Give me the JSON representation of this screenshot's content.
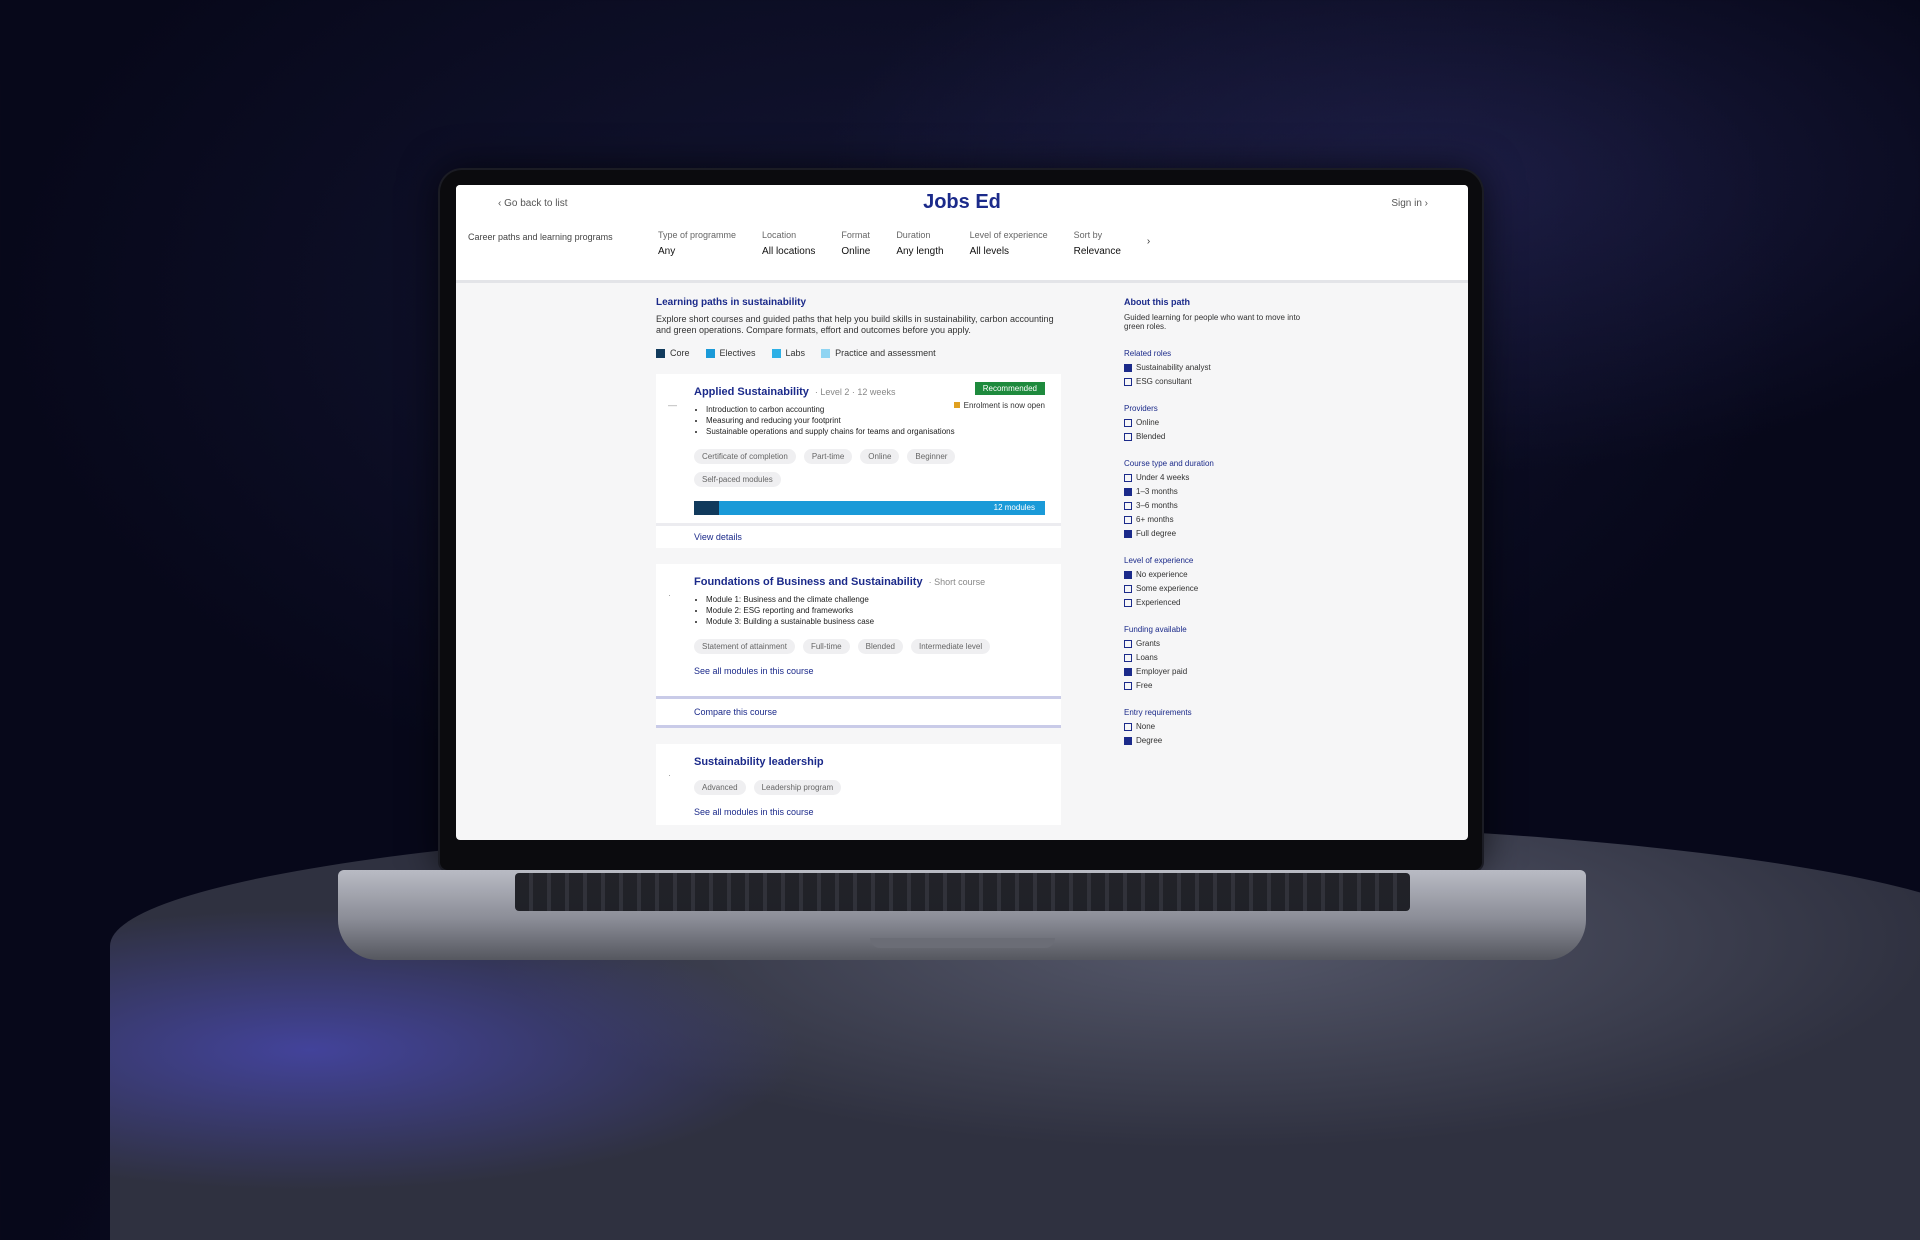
{
  "site": {
    "back_label": "‹ Go back to list",
    "logo": "Jobs Ed",
    "signin_label": "Sign in ›",
    "search_text": "Career paths and learning programs"
  },
  "filters": [
    {
      "label": "Type of programme",
      "value": "Any"
    },
    {
      "label": "Location",
      "value": "All locations"
    },
    {
      "label": "Format",
      "value": "Online"
    },
    {
      "label": "Duration",
      "value": "Any length"
    },
    {
      "label": "Level of experience",
      "value": "All levels"
    },
    {
      "label": "Sort by",
      "value": "Relevance"
    }
  ],
  "more_label": "›",
  "results": {
    "title": "Learning paths in sustainability",
    "description": "Explore short courses and guided paths that help you build skills in sustainability, carbon accounting and green operations. Compare formats, effort and outcomes before you apply.",
    "legend": [
      "Core",
      "Electives",
      "Labs",
      "Practice and assessment"
    ],
    "legend_colors": [
      "#113a5c",
      "#1a9ad8",
      "#2db0e6",
      "#8fd4f2"
    ]
  },
  "cards": [
    {
      "badge": "Recommended",
      "title": "Applied Sustainability",
      "subtitle": "· Level 2 · 12 weeks",
      "status": "Enrolment is now open",
      "bullets": [
        "Introduction to carbon accounting",
        "Measuring and reducing your footprint",
        "Sustainable operations and supply chains for teams and organisations"
      ],
      "tags": [
        "Certificate of completion",
        "Part-time",
        "Online",
        "Beginner",
        "Self-paced modules"
      ],
      "progress": 0.07,
      "progress_label": "12 modules",
      "footer": "View details"
    },
    {
      "title": "Foundations of Business and Sustainability",
      "subtitle": "· Short course",
      "bullets": [
        "Module 1: Business and the climate challenge",
        "Module 2: ESG reporting and frameworks",
        "Module 3: Building a sustainable business case"
      ],
      "tags": [
        "Statement of attainment",
        "Full-time",
        "Blended",
        "Intermediate level"
      ],
      "link": "See all modules in this course",
      "compare": "Compare this course"
    },
    {
      "title": "Sustainability leadership",
      "tags": [
        "Advanced",
        "Leadership program"
      ],
      "link": "See all modules in this course"
    }
  ],
  "sidebar": {
    "title": "About this path",
    "intro": "Guided learning for people who want to move into green roles.",
    "groups": [
      {
        "heading": "Related roles",
        "items": [
          "Sustainability analyst",
          "ESG consultant"
        ]
      },
      {
        "heading": "Providers",
        "items": [
          "Online",
          "Blended"
        ]
      },
      {
        "heading": "Course type and duration",
        "items": [
          "Under 4 weeks",
          "1–3 months",
          "3–6 months",
          "6+ months",
          "Full degree"
        ]
      },
      {
        "heading": "Level of experience",
        "items": [
          "No experience",
          "Some experience",
          "Experienced"
        ]
      },
      {
        "heading": "Funding available",
        "items": [
          "Grants",
          "Loans",
          "Employer paid",
          "Free"
        ]
      },
      {
        "heading": "Entry requirements",
        "items": [
          "None",
          "Degree"
        ]
      }
    ]
  }
}
